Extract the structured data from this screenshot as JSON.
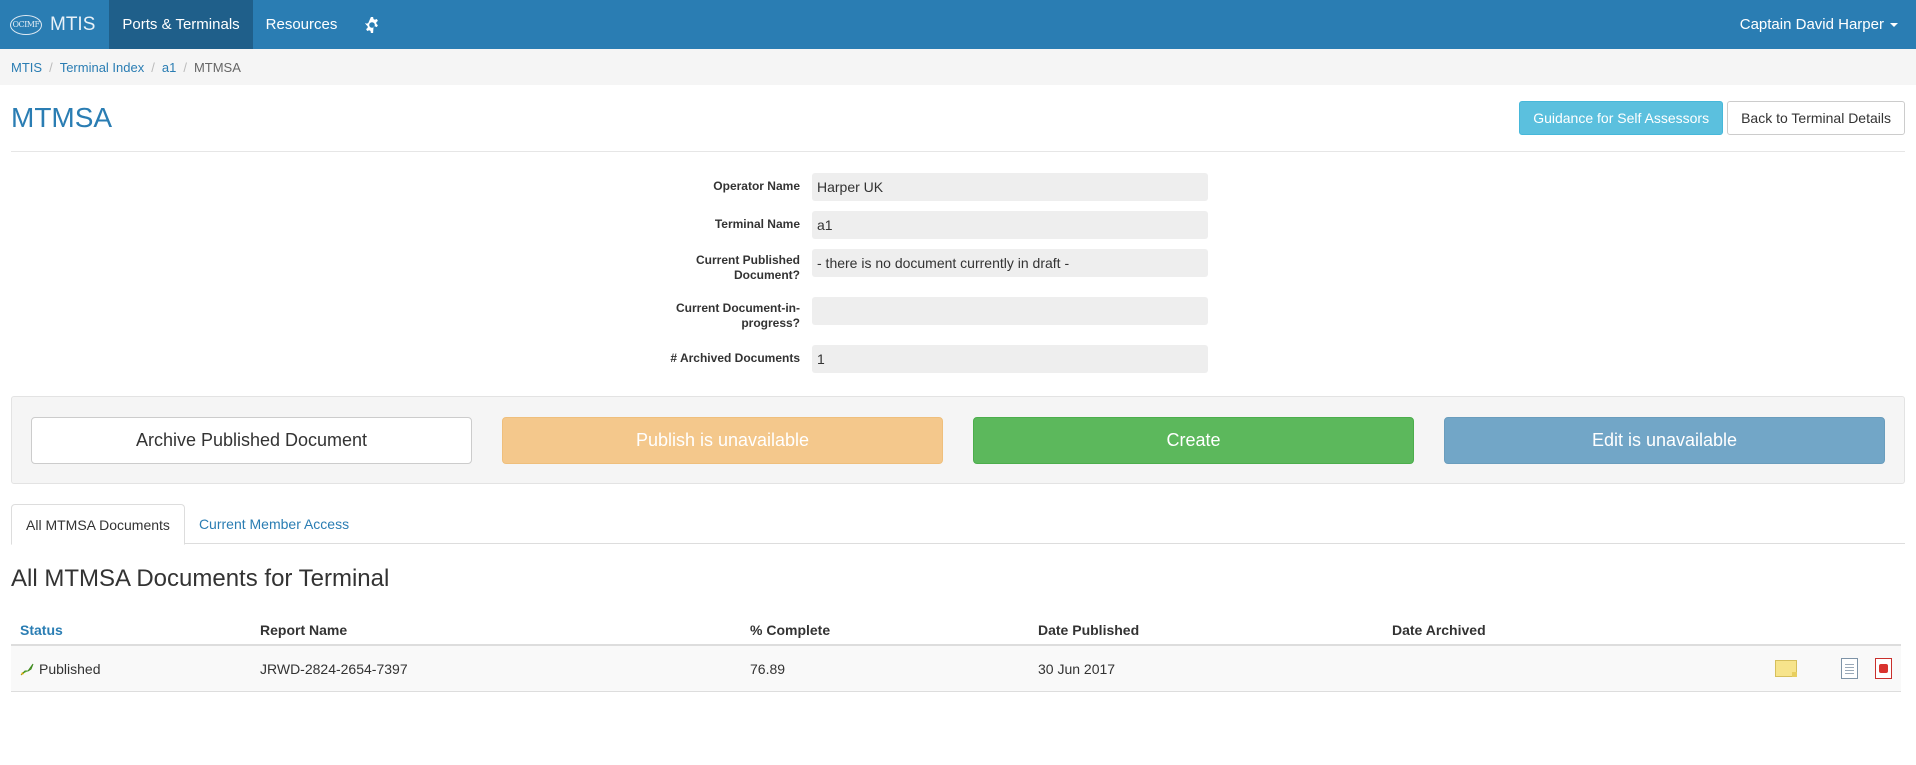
{
  "navbar": {
    "brand_logo": "OCIMF",
    "brand_name": "MTIS",
    "items": [
      {
        "label": "Ports & Terminals",
        "active": true
      },
      {
        "label": "Resources",
        "active": false
      }
    ],
    "gear_icon": "gear-icon",
    "user": "Captain David Harper"
  },
  "breadcrumb": {
    "items": [
      "MTIS",
      "Terminal Index",
      "a1"
    ],
    "current": "MTMSA"
  },
  "header": {
    "title": "MTMSA",
    "guidance_label": "Guidance for Self Assessors",
    "back_label": "Back to Terminal Details"
  },
  "form": {
    "operator_label": "Operator Name",
    "operator_value": "Harper UK",
    "terminal_label": "Terminal Name",
    "terminal_value": "a1",
    "published_label": "Current Published Document?",
    "published_value": "- there is no document currently in draft -",
    "inprogress_label": "Current Document-in-progress?",
    "inprogress_value": "",
    "archived_label": "# Archived Documents",
    "archived_value": "1"
  },
  "actions": {
    "archive": "Archive Published Document",
    "publish": "Publish is unavailable",
    "create": "Create",
    "edit": "Edit is unavailable"
  },
  "tabs": [
    {
      "label": "All MTMSA Documents",
      "active": true
    },
    {
      "label": "Current Member Access",
      "active": false
    }
  ],
  "section_title": "All MTMSA Documents for Terminal",
  "table": {
    "headers": [
      "Status",
      "Report Name",
      "% Complete",
      "Date Published",
      "Date Archived"
    ],
    "rows": [
      {
        "status": "Published",
        "report_name": "JRWD-2824-2654-7397",
        "complete": "76.89",
        "date_published": "30 Jun 2017",
        "date_archived": ""
      }
    ]
  },
  "colors": {
    "navbar": "#2a7db3",
    "info": "#5bc0de",
    "success": "#5cb85c",
    "warning_disabled": "#f4c88c",
    "primary_disabled": "#72a6c7"
  }
}
